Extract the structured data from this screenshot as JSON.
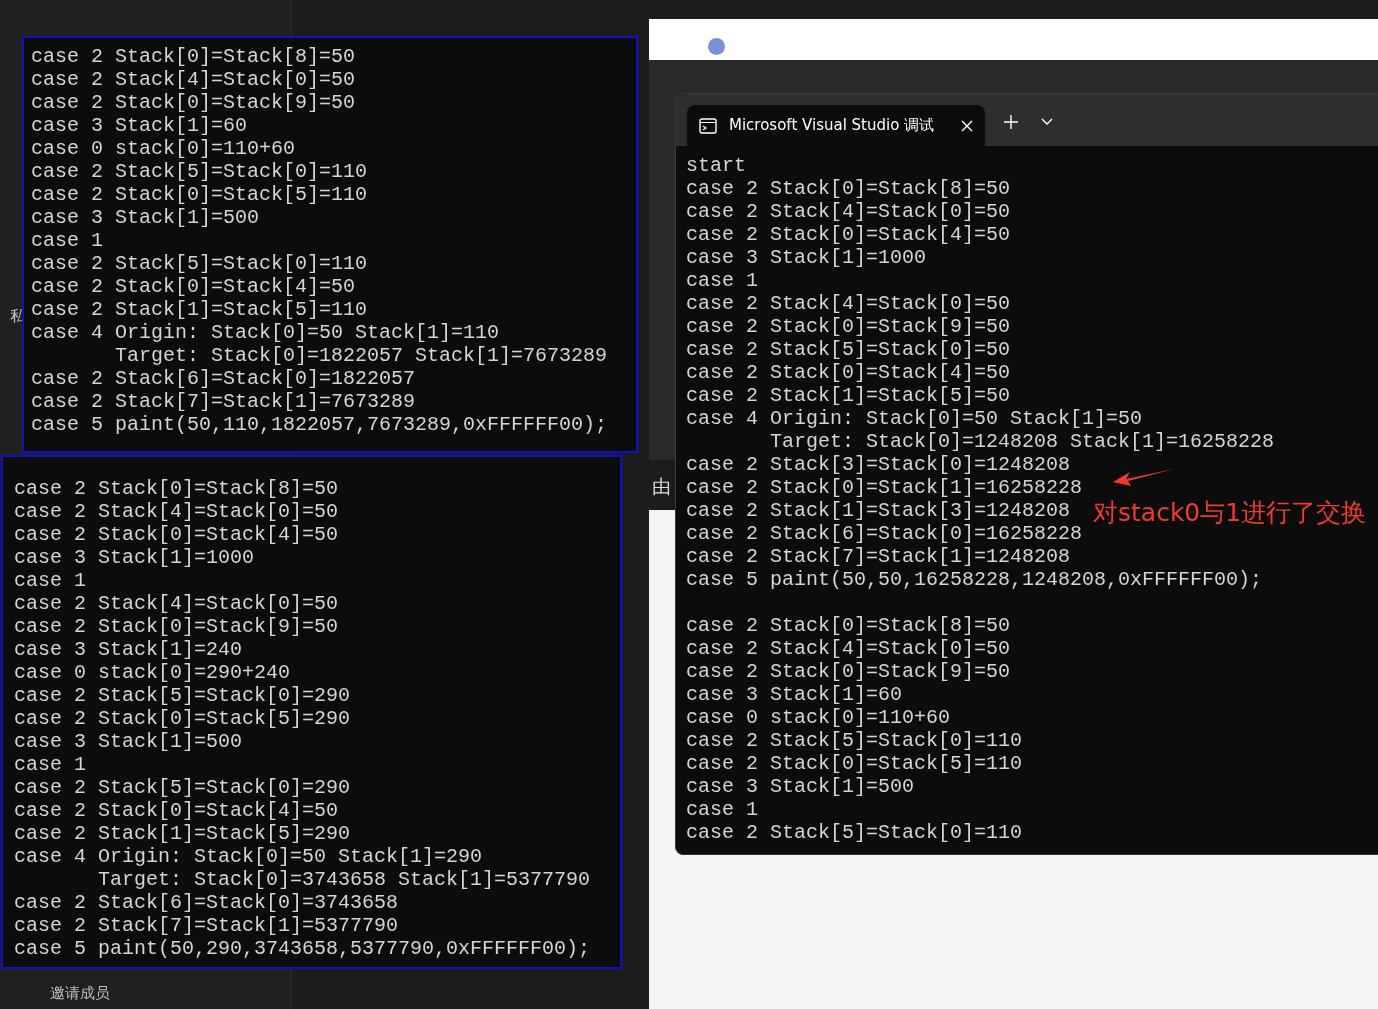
{
  "background": {
    "sidebar_labels": [
      "私",
      "邀请成员"
    ],
    "side_label": "由"
  },
  "console_a": {
    "lines": [
      "case 2 Stack[0]=Stack[8]=50",
      "case 2 Stack[4]=Stack[0]=50",
      "case 2 Stack[0]=Stack[9]=50",
      "case 3 Stack[1]=60",
      "case 0 stack[0]=110+60",
      "case 2 Stack[5]=Stack[0]=110",
      "case 2 Stack[0]=Stack[5]=110",
      "case 3 Stack[1]=500",
      "case 1",
      "case 2 Stack[5]=Stack[0]=110",
      "case 2 Stack[0]=Stack[4]=50",
      "case 2 Stack[1]=Stack[5]=110",
      "case 4 Origin: Stack[0]=50 Stack[1]=110",
      "       Target: Stack[0]=1822057 Stack[1]=7673289",
      "case 2 Stack[6]=Stack[0]=1822057",
      "case 2 Stack[7]=Stack[1]=7673289",
      "case 5 paint(50,110,1822057,7673289,0xFFFFFF00);"
    ]
  },
  "console_b": {
    "lines": [
      "case 2 Stack[0]=Stack[8]=50",
      "case 2 Stack[4]=Stack[0]=50",
      "case 2 Stack[0]=Stack[4]=50",
      "case 3 Stack[1]=1000",
      "case 1",
      "case 2 Stack[4]=Stack[0]=50",
      "case 2 Stack[0]=Stack[9]=50",
      "case 3 Stack[1]=240",
      "case 0 stack[0]=290+240",
      "case 2 Stack[5]=Stack[0]=290",
      "case 2 Stack[0]=Stack[5]=290",
      "case 3 Stack[1]=500",
      "case 1",
      "case 2 Stack[5]=Stack[0]=290",
      "case 2 Stack[0]=Stack[4]=50",
      "case 2 Stack[1]=Stack[5]=290",
      "case 4 Origin: Stack[0]=50 Stack[1]=290",
      "       Target: Stack[0]=3743658 Stack[1]=5377790",
      "case 2 Stack[6]=Stack[0]=3743658",
      "case 2 Stack[7]=Stack[1]=5377790",
      "case 5 paint(50,290,3743658,5377790,0xFFFFFF00);"
    ]
  },
  "terminal": {
    "tab": {
      "title": "Microsoft Visual Studio 调试",
      "selected": true
    },
    "blocks": [
      [
        "start",
        "case 2 Stack[0]=Stack[8]=50",
        "case 2 Stack[4]=Stack[0]=50",
        "case 2 Stack[0]=Stack[4]=50",
        "case 3 Stack[1]=1000",
        "case 1",
        "case 2 Stack[4]=Stack[0]=50",
        "case 2 Stack[0]=Stack[9]=50",
        "case 2 Stack[5]=Stack[0]=50",
        "case 2 Stack[0]=Stack[4]=50",
        "case 2 Stack[1]=Stack[5]=50",
        "case 4 Origin: Stack[0]=50 Stack[1]=50",
        "       Target: Stack[0]=1248208 Stack[1]=16258228",
        "case 2 Stack[3]=Stack[0]=1248208",
        "case 2 Stack[0]=Stack[1]=16258228",
        "case 2 Stack[1]=Stack[3]=1248208",
        "case 2 Stack[6]=Stack[0]=16258228",
        "case 2 Stack[7]=Stack[1]=1248208",
        "case 5 paint(50,50,16258228,1248208,0xFFFFFF00);"
      ],
      [
        "case 2 Stack[0]=Stack[8]=50",
        "case 2 Stack[4]=Stack[0]=50",
        "case 2 Stack[0]=Stack[9]=50",
        "case 3 Stack[1]=60",
        "case 0 stack[0]=110+60",
        "case 2 Stack[5]=Stack[0]=110",
        "case 2 Stack[0]=Stack[5]=110",
        "case 3 Stack[1]=500",
        "case 1",
        "case 2 Stack[5]=Stack[0]=110"
      ]
    ]
  },
  "annotation": {
    "text": "对stack0与1进行了交换"
  }
}
